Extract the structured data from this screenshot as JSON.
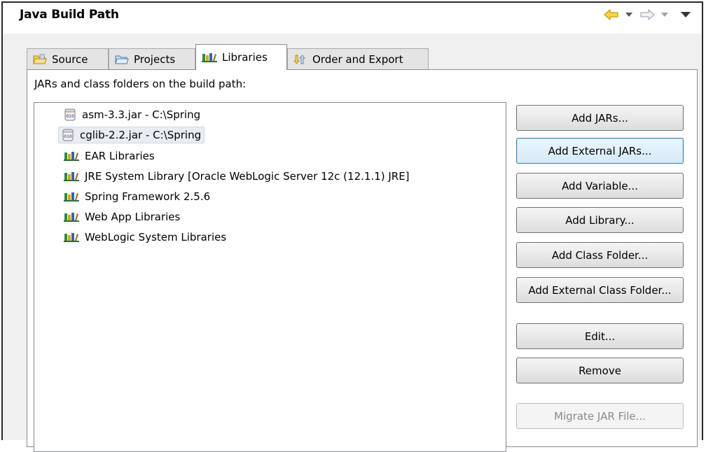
{
  "header": {
    "title": "Java Build Path",
    "nav": {
      "back_icon": "back-arrow-icon",
      "forward_icon": "forward-arrow-icon",
      "menu_icon": "view-menu-icon"
    }
  },
  "tabs": [
    {
      "label": "Source",
      "icon": "source-folder-icon",
      "active": false
    },
    {
      "label": "Projects",
      "icon": "project-folder-icon",
      "active": false
    },
    {
      "label": "Libraries",
      "icon": "library-icon",
      "active": true
    },
    {
      "label": "Order and Export",
      "icon": "order-export-icon",
      "active": false
    }
  ],
  "libraries_panel": {
    "label": "JARs and class folders on the build path:",
    "items": [
      {
        "label": "asm-3.3.jar - C:\\Spring",
        "icon": "jar-icon",
        "selected": false
      },
      {
        "label": "cglib-2.2.jar - C:\\Spring",
        "icon": "jar-icon",
        "selected": true
      },
      {
        "label": "EAR Libraries",
        "icon": "library-icon",
        "selected": false
      },
      {
        "label": "JRE System Library [Oracle WebLogic Server 12c (12.1.1) JRE]",
        "icon": "library-icon",
        "selected": false
      },
      {
        "label": "Spring Framework 2.5.6",
        "icon": "library-icon",
        "selected": false
      },
      {
        "label": "Web App Libraries",
        "icon": "library-icon",
        "selected": false
      },
      {
        "label": "WebLogic System Libraries",
        "icon": "library-icon",
        "selected": false
      }
    ]
  },
  "buttons": {
    "add_jars": "Add JARs...",
    "add_external_jars": "Add External JARs...",
    "add_variable": "Add Variable...",
    "add_library": "Add Library...",
    "add_class_folder": "Add Class Folder...",
    "add_external_class_folder": "Add External Class Folder...",
    "edit": "Edit...",
    "remove": "Remove",
    "migrate_jar_file": "Migrate JAR File..."
  },
  "colors": {
    "panel_bg": "#ffffff",
    "dialog_bg": "#f0f0f0",
    "focus_border": "#3c7fb1",
    "selection_bg": "#e8edf2",
    "back_arrow": "#e6b800",
    "library_icon_shelf": "#2d8a4e"
  }
}
